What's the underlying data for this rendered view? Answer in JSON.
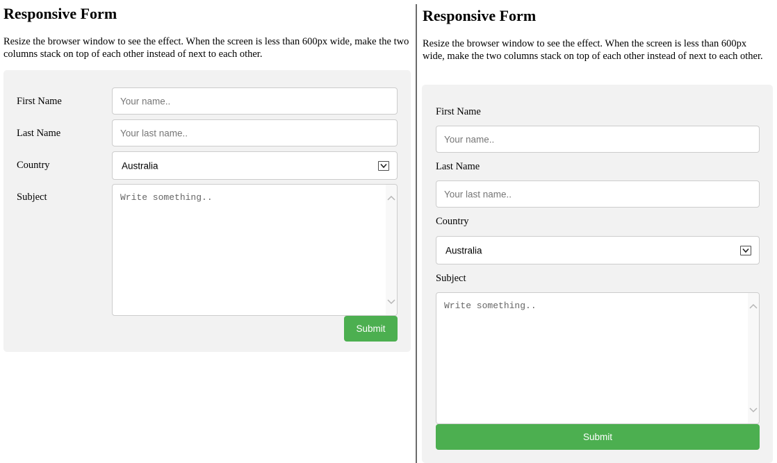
{
  "title": "Responsive Form",
  "description": "Resize the browser window to see the effect. When the screen is less than 600px wide, make the two columns stack on top of each other instead of next to each other.",
  "form": {
    "first_name_label": "First Name",
    "first_name_placeholder": "Your name..",
    "last_name_label": "Last Name",
    "last_name_placeholder": "Your last name..",
    "country_label": "Country",
    "country_value": "Australia",
    "subject_label": "Subject",
    "subject_placeholder": "Write something..",
    "submit_label": "Submit"
  },
  "colors": {
    "form_background": "#f2f2f2",
    "submit_button": "#4caf50",
    "field_border": "#cccccc"
  },
  "icons": {
    "dropdown": "chevron-down-icon",
    "scroll_up": "scroll-up-arrow-icon",
    "scroll_down": "scroll-down-arrow-icon"
  }
}
